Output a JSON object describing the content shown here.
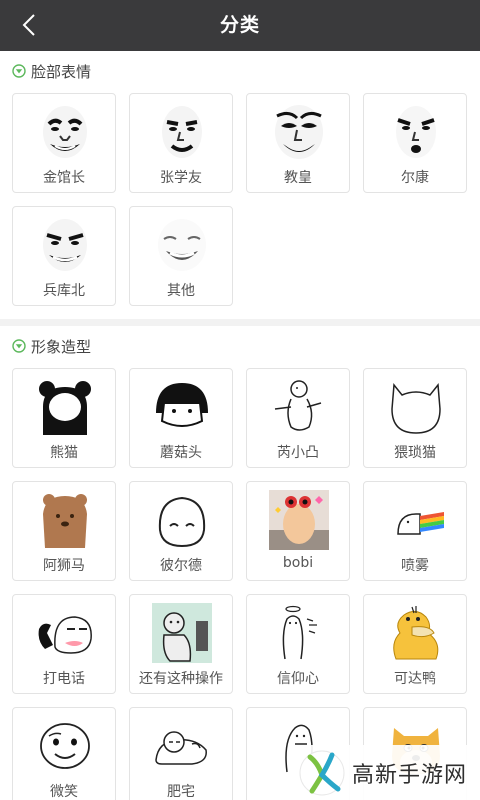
{
  "header": {
    "title": "分类"
  },
  "sections": [
    {
      "title": "脸部表情",
      "items": [
        {
          "label": "金馆长",
          "icon": "face-meme-icon"
        },
        {
          "label": "张学友",
          "icon": "face-meme-icon"
        },
        {
          "label": "教皇",
          "icon": "face-meme-icon"
        },
        {
          "label": "尔康",
          "icon": "face-meme-icon"
        },
        {
          "label": "兵库北",
          "icon": "face-meme-icon"
        },
        {
          "label": "其他",
          "icon": "face-meme-icon"
        }
      ]
    },
    {
      "title": "形象造型",
      "items": [
        {
          "label": "熊猫",
          "icon": "panda-icon"
        },
        {
          "label": "蘑菇头",
          "icon": "mushroom-head-icon"
        },
        {
          "label": "芮小凸",
          "icon": "doodle-figure-icon"
        },
        {
          "label": "猥琐猫",
          "icon": "cat-outline-icon"
        },
        {
          "label": "阿狮马",
          "icon": "alpaca-icon"
        },
        {
          "label": "彼尔德",
          "icon": "blob-face-icon"
        },
        {
          "label": "bobi",
          "icon": "cat-photo-icon"
        },
        {
          "label": "喷雾",
          "icon": "rainbow-spray-icon"
        },
        {
          "label": "打电话",
          "icon": "phone-call-icon"
        },
        {
          "label": "还有这种操作",
          "icon": "comic-scene-icon"
        },
        {
          "label": "信仰心",
          "icon": "angel-doodle-icon"
        },
        {
          "label": "可达鸭",
          "icon": "psyduck-icon"
        },
        {
          "label": "微笑",
          "icon": "smile-face-icon"
        },
        {
          "label": "肥宅",
          "icon": "lazy-figure-icon"
        },
        {
          "label": "",
          "icon": "doodle-figure-icon"
        },
        {
          "label": "",
          "icon": "doge-icon"
        }
      ]
    }
  ],
  "watermark": {
    "text": "高新手游网"
  },
  "colors": {
    "accent": "#5cb85c",
    "topbar": "#3a3a3c"
  }
}
